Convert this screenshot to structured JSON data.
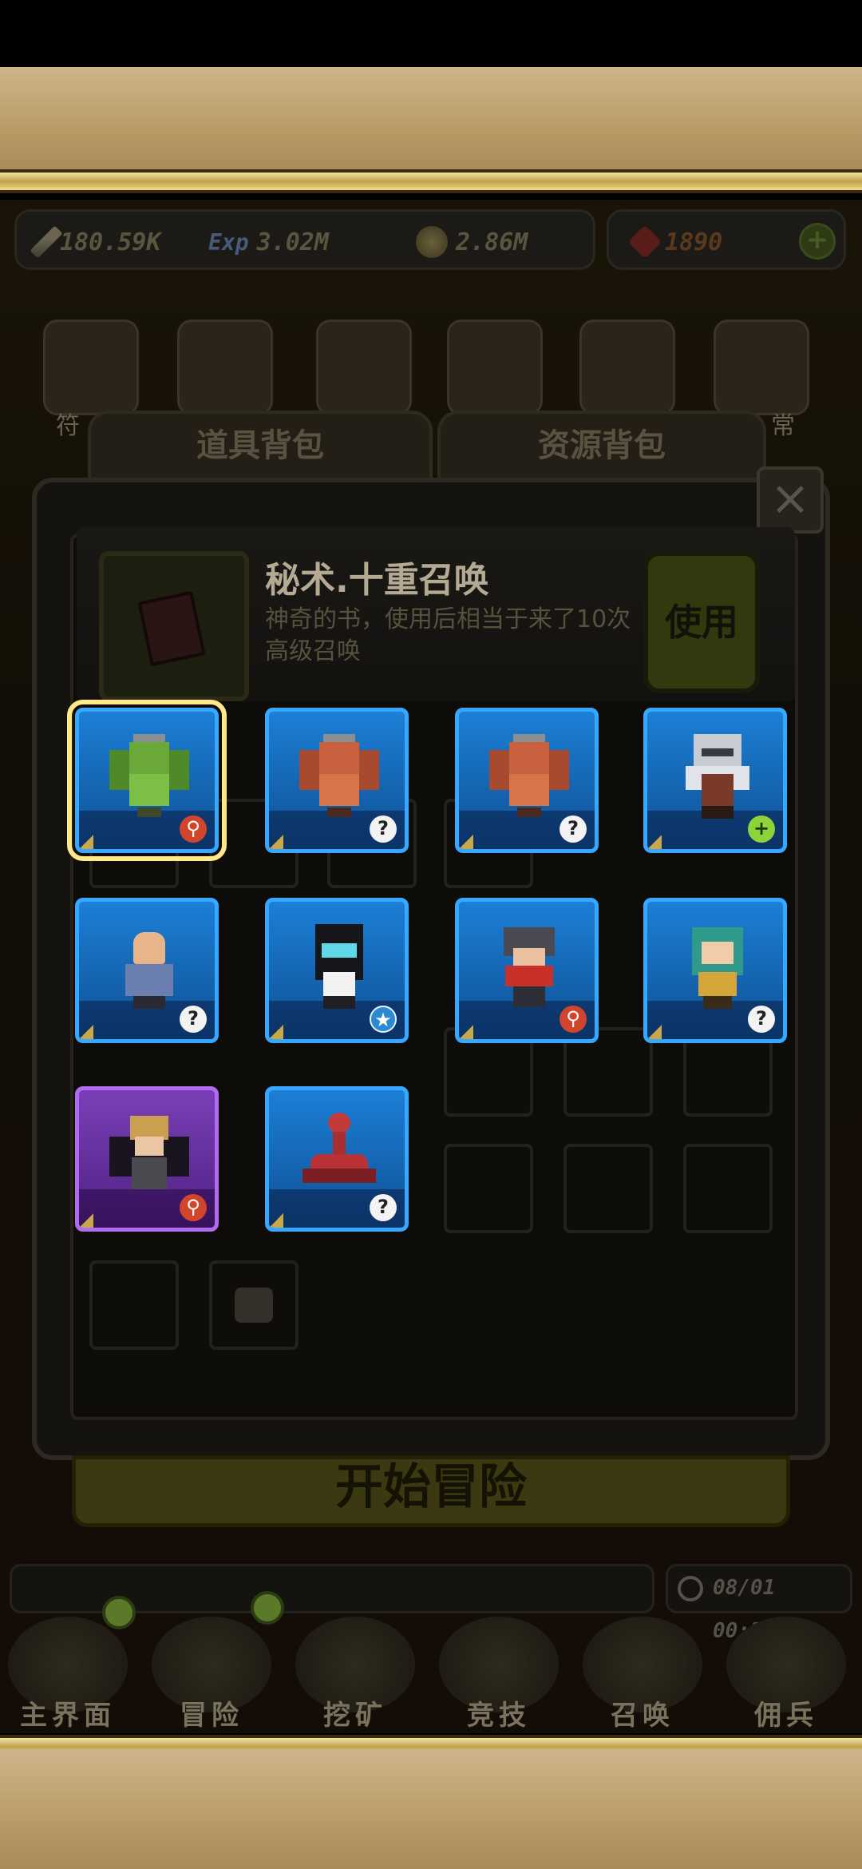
{
  "resources": {
    "attack": "180.59K",
    "exp_label": "Exp",
    "exp": "3.02M",
    "gold": "2.86M",
    "gems": "1890",
    "add_symbol": "+"
  },
  "menu": {
    "left_label": "符",
    "right_label": "常"
  },
  "tabs": {
    "items": "道具背包",
    "resources": "资源背包"
  },
  "close_symbol": "×",
  "selected_item": {
    "name": "秘术.十重召唤",
    "description": "神奇的书，使用后相当于来了10次高级召唤",
    "use_label": "使用"
  },
  "heroes": [
    {
      "name": "green-gargoyle",
      "rarity": "blue",
      "badge": "r",
      "badge_symbol": "⚲"
    },
    {
      "name": "red-gargoyle",
      "rarity": "blue",
      "badge": "q",
      "badge_symbol": "?"
    },
    {
      "name": "red-gargoyle",
      "rarity": "blue",
      "badge": "q",
      "badge_symbol": "?"
    },
    {
      "name": "armored-knight",
      "rarity": "blue",
      "badge": "g",
      "badge_symbol": "+"
    },
    {
      "name": "bald-monk",
      "rarity": "blue",
      "badge": "q",
      "badge_symbol": "?"
    },
    {
      "name": "masked-girl",
      "rarity": "blue",
      "badge": "s",
      "badge_symbol": "★"
    },
    {
      "name": "red-scarf-ninja",
      "rarity": "blue",
      "badge": "r",
      "badge_symbol": "⚲"
    },
    {
      "name": "teal-hair-girl",
      "rarity": "blue",
      "badge": "q",
      "badge_symbol": "?"
    },
    {
      "name": "winged-warrior",
      "rarity": "purple",
      "badge": "r",
      "badge_symbol": "⚲"
    },
    {
      "name": "red-scorpion",
      "rarity": "blue",
      "badge": "q",
      "badge_symbol": "?"
    }
  ],
  "start_banner": "开始冒险",
  "clock": "08/01 00:36",
  "nav": [
    "主界面",
    "冒险",
    "挖矿",
    "竞技",
    "召唤",
    "佣兵"
  ],
  "colors": {
    "card_blue": "#1c7fd6",
    "card_purple": "#7a3fb8",
    "selected_outline": "#ffe98a"
  }
}
